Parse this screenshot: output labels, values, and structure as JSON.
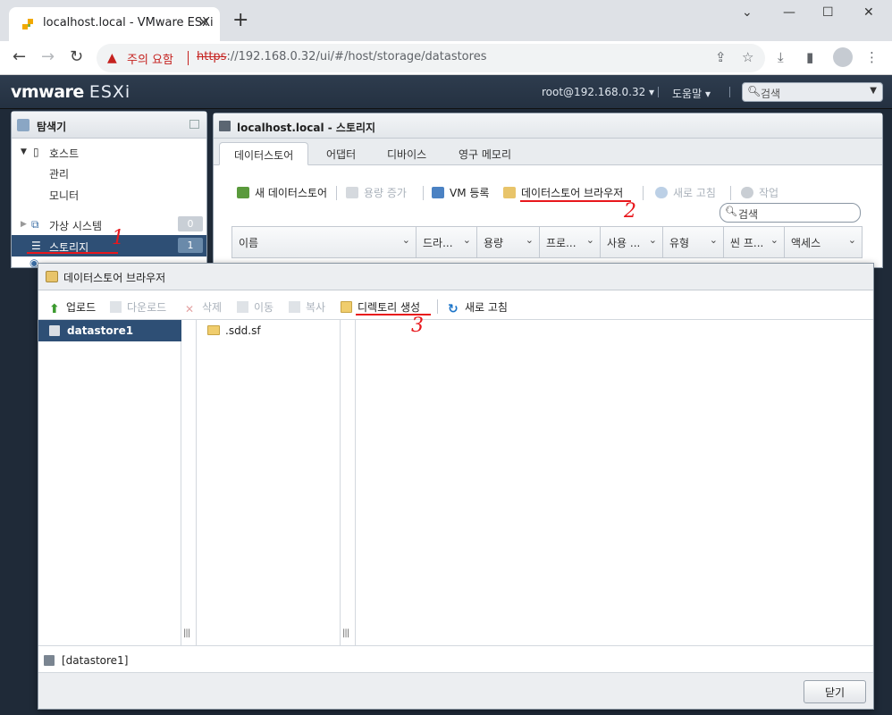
{
  "browser": {
    "tab_title": "localhost.local - VMware ESXi",
    "security_label": "주의 요함",
    "url_scheme": "https",
    "url_rest": "://192.168.0.32/ui/#/host/storage/datastores"
  },
  "esxi": {
    "logo_brand": "vmware",
    "logo_product": "ESXi",
    "user": "root@192.168.0.32",
    "help": "도움말",
    "search_placeholder": "검색"
  },
  "navigator": {
    "title": "탐색기",
    "items": [
      {
        "label": "호스트"
      },
      {
        "label": "관리"
      },
      {
        "label": "모니터"
      },
      {
        "label": "가상 시스템",
        "count": "0"
      },
      {
        "label": "스토리지",
        "count": "1"
      }
    ]
  },
  "storage": {
    "title": "localhost.local - 스토리지",
    "tabs": [
      "데이터스토어",
      "어댑터",
      "디바이스",
      "영구 메모리"
    ],
    "actions": [
      "새 데이터스토어",
      "용량 증가",
      "VM 등록",
      "데이터스토어 브라우저",
      "새로 고침",
      "작업"
    ],
    "search_placeholder": "검색",
    "columns": [
      "이름",
      "드라...",
      "용량",
      "프로...",
      "사용 ...",
      "유형",
      "씬 프...",
      "액세스"
    ]
  },
  "annotations": [
    "1",
    "2",
    "3"
  ],
  "dialog": {
    "title": "데이터스토어 브라우저",
    "toolbar": [
      "업로드",
      "다운로드",
      "삭제",
      "이동",
      "복사",
      "디렉토리 생성",
      "새로 고침"
    ],
    "datastores": [
      "datastore1"
    ],
    "folders": [
      ".sdd.sf"
    ],
    "path": "[datastore1]",
    "close_label": "닫기"
  },
  "colors": {
    "accent_selected": "#2e4f75",
    "annotation_red": "#e8171c",
    "header_dark": "#243141"
  }
}
